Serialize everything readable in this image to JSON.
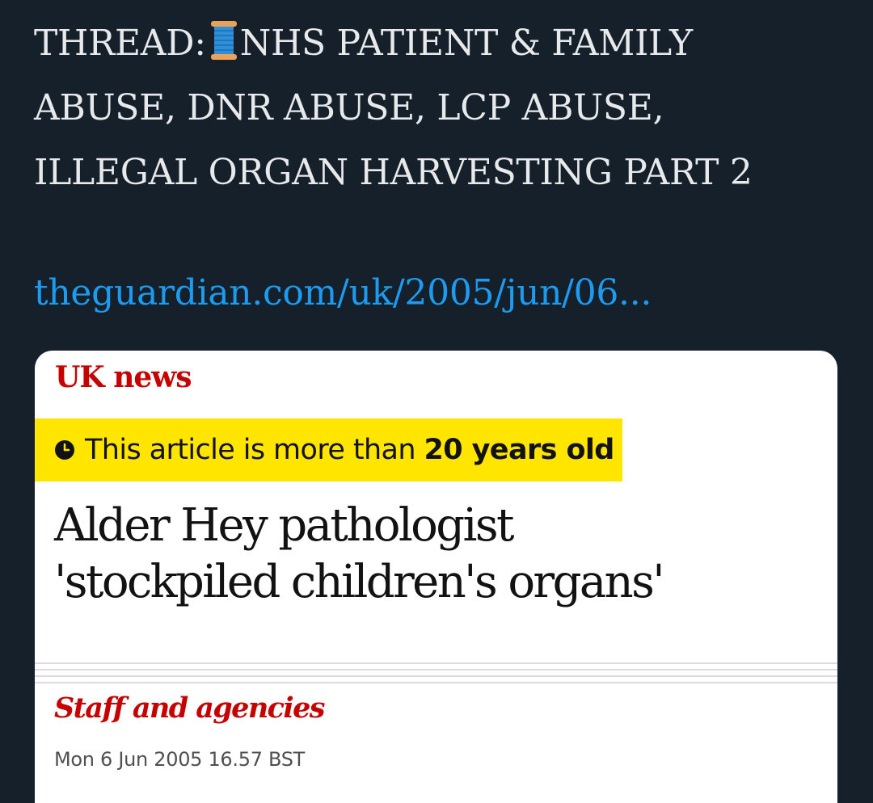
{
  "tweet": {
    "text_line_1_prefix": "THREAD:",
    "text_line_1_suffix": "NHS PATIENT & FAMILY",
    "text_line_2": "ABUSE, DNR ABUSE, LCP ABUSE,",
    "text_line_3": "ILLEGAL ORGAN HARVESTING PART 2",
    "thread_icon": "spool-of-thread-emoji",
    "link_text": "theguardian.com/uk/2005/jun/06..."
  },
  "card": {
    "section": "UK news",
    "age_banner": {
      "icon": "clock-icon",
      "text": "This article is more than ",
      "emphasis": "20 years old"
    },
    "headline_line_1": "Alder Hey pathologist",
    "headline_line_2": "'stockpiled children's organs'",
    "byline": "Staff and agencies",
    "date": "Mon 6 Jun 2005 16.57 BST"
  },
  "colors": {
    "background": "#15202b",
    "tweet_text": "#e7e9ea",
    "link": "#1d9bf0",
    "guardian_red": "#c70000",
    "banner_yellow": "#ffe500"
  }
}
